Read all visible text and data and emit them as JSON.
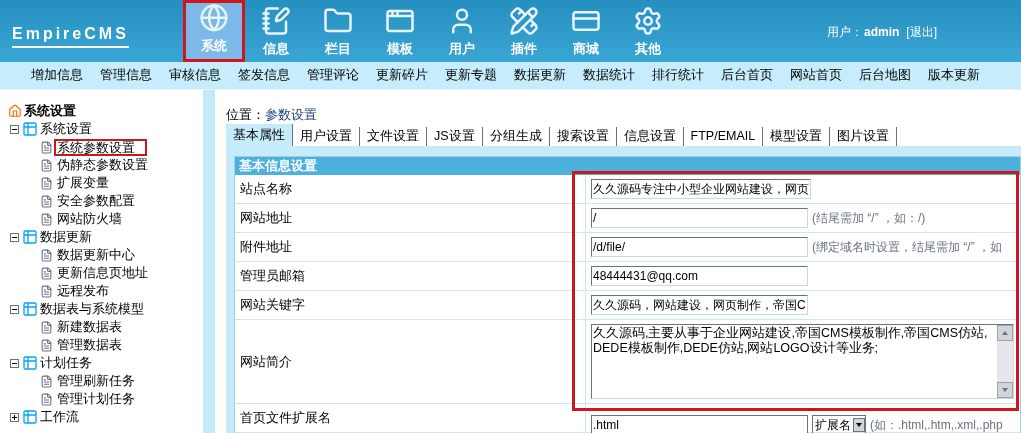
{
  "logo": {
    "text": "EmpireCMS"
  },
  "nav": [
    {
      "label": "系统",
      "selected": true
    },
    {
      "label": "信息",
      "selected": false
    },
    {
      "label": "栏目",
      "selected": false
    },
    {
      "label": "模板",
      "selected": false
    },
    {
      "label": "用户",
      "selected": false
    },
    {
      "label": "插件",
      "selected": false
    },
    {
      "label": "商城",
      "selected": false
    },
    {
      "label": "其他",
      "selected": false
    }
  ],
  "user": {
    "label": "用户：",
    "name": "admin",
    "logout": "[退出]"
  },
  "subnav": [
    "增加信息",
    "管理信息",
    "审核信息",
    "签发信息",
    "管理评论",
    "更新碎片",
    "更新专题",
    "数据更新",
    "数据统计",
    "排行统计",
    "后台首页",
    "网站首页",
    "后台地图",
    "版本更新"
  ],
  "sidebar": {
    "title": "系统设置",
    "groups": [
      {
        "label": "系统设置",
        "expanded": true,
        "children": [
          {
            "label": "系统参数设置",
            "selected": true
          },
          {
            "label": "伪静态参数设置",
            "selected": false
          },
          {
            "label": "扩展变量",
            "selected": false
          },
          {
            "label": "安全参数配置",
            "selected": false
          },
          {
            "label": "网站防火墙",
            "selected": false
          }
        ]
      },
      {
        "label": "数据更新",
        "expanded": true,
        "children": [
          {
            "label": "数据更新中心",
            "selected": false
          },
          {
            "label": "更新信息页地址",
            "selected": false
          },
          {
            "label": "远程发布",
            "selected": false
          }
        ]
      },
      {
        "label": "数据表与系统模型",
        "expanded": true,
        "children": [
          {
            "label": "新建数据表",
            "selected": false
          },
          {
            "label": "管理数据表",
            "selected": false
          }
        ]
      },
      {
        "label": "计划任务",
        "expanded": true,
        "children": [
          {
            "label": "管理刷新任务",
            "selected": false
          },
          {
            "label": "管理计划任务",
            "selected": false
          }
        ]
      },
      {
        "label": "工作流",
        "expanded": false
      }
    ]
  },
  "location": {
    "label": "位置：",
    "path": "参数设置"
  },
  "tabs": [
    {
      "label": "基本属性",
      "selected": true
    },
    {
      "label": "用户设置",
      "selected": false
    },
    {
      "label": "文件设置",
      "selected": false
    },
    {
      "label": "JS设置",
      "selected": false
    },
    {
      "label": "分组生成",
      "selected": false
    },
    {
      "label": "搜索设置",
      "selected": false
    },
    {
      "label": "信息设置",
      "selected": false
    },
    {
      "label": "FTP/EMAIL",
      "selected": false
    },
    {
      "label": "模型设置",
      "selected": false
    },
    {
      "label": "图片设置",
      "selected": false
    }
  ],
  "form": {
    "title": "基本信息设置",
    "highlighted": true,
    "rows": [
      {
        "kind": "text",
        "label": "站点名称",
        "value": "久久源码专注中小型企业网站建设，网页"
      },
      {
        "kind": "text",
        "label": "网站地址",
        "value": "/",
        "hint": "(结尾需加 “/” ，如：/)"
      },
      {
        "kind": "text",
        "label": "附件地址",
        "value": "/d/file/",
        "hint": "(绑定域名时设置，结尾需加 “/” ，如"
      },
      {
        "kind": "text",
        "label": "管理员邮箱",
        "value": "48444431@qq.com"
      },
      {
        "kind": "text",
        "label": "网站关键字",
        "value": "久久源码，网站建设，网页制作，帝国C"
      },
      {
        "kind": "textarea",
        "label": "网站简介",
        "value": "久久源码,主要从事于企业网站建设,帝国CMS模板制作,帝国CMS仿站,DEDE模板制作,DEDE仿站,网站LOGO设计等业务;"
      },
      {
        "kind": "select",
        "label": "首页文件扩展名",
        "value": ".html",
        "option": "扩展名",
        "hint": "(如：.html,.htm,.xml,.php"
      }
    ]
  }
}
